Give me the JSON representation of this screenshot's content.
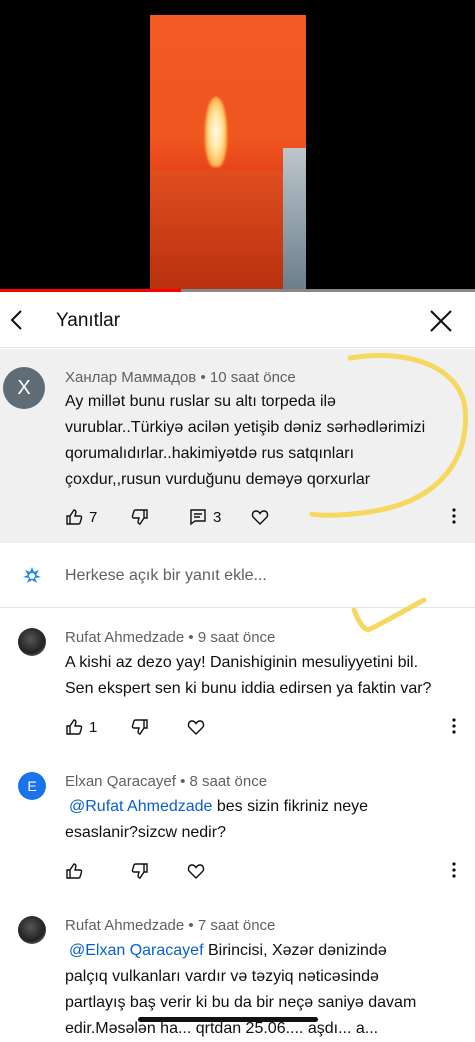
{
  "video": {
    "progress": 0.38,
    "colors": {
      "sky": "#f25a24",
      "sea": "#b8300e",
      "flame": "#fff0b0"
    }
  },
  "replies_panel": {
    "title": "Yanıtlar",
    "back_icon": "chevron-left-icon",
    "close_icon": "close-icon"
  },
  "parent_comment": {
    "avatar_letter": "X",
    "author": "Ханлар Маммадов",
    "time": "10 saat önce",
    "lines": [
      "Ay millət bunu ruslar su altı torpeda ilə",
      "vurublar..Türkiyə acilən yetişib dəniz sərhədlərimizi",
      "qorumalıdırlar..hakimiyətdə rus satqınları",
      "çoxdur,,rusun vurduğunu deməyə qorxurlar"
    ],
    "likes": "7",
    "replies": "3"
  },
  "add_reply": {
    "placeholder": "Herkese açık bir yanıt ekle..."
  },
  "replies": [
    {
      "author": "Rufat Ahmedzade",
      "time": "9 saat önce",
      "lines": [
        "A kishi az dezo yay! Danishiginin mesuliyyetini bil.",
        "Sen ekspert sen ki bunu iddia edirsen ya faktin var?"
      ],
      "likes": "1"
    },
    {
      "avatar_letter": "E",
      "author": "Elxan Qaracayef",
      "time": "8 saat önce",
      "mention": "@Rufat Ahmedzade",
      "first_line_rest": " bes sizin fikriniz neye",
      "lines": [
        "esaslanir?sizcw nedir?"
      ]
    },
    {
      "author": "Rufat Ahmedzade",
      "time": "7 saat önce",
      "mention": "@Elxan Qaracayef",
      "first_line_rest": " Birincisi, Xəzər dənizində",
      "lines": [
        "palçıq vulkanları vardır və təzyiq nəticəsində",
        "partlayış baş verir ki bu da bir neçə saniyə davam",
        "edir.Məsələn ha... qrtdan 25.06.... aşdı... a..."
      ]
    }
  ],
  "colors": {
    "accent_link": "#065fd4",
    "annotation": "#f6d860",
    "panel_highlight": "#f0f0f0"
  }
}
